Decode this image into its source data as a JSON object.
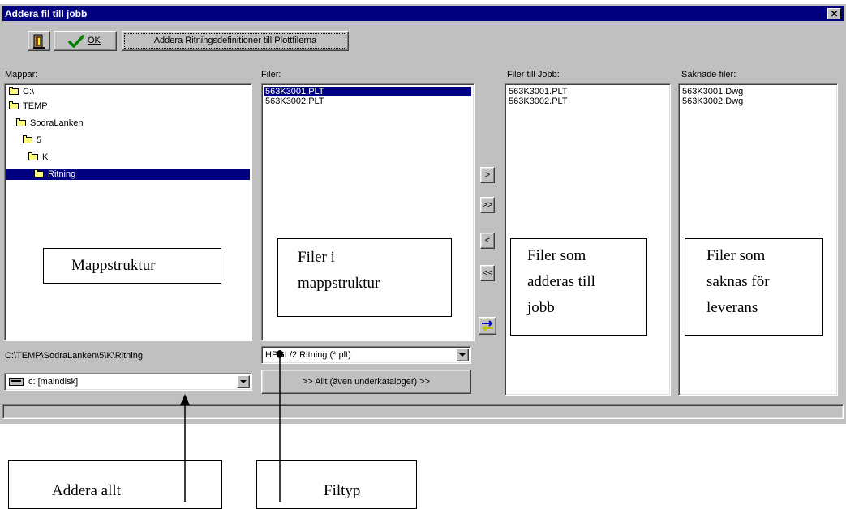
{
  "window": {
    "title": "Addera fil till jobb",
    "close_glyph": "✕"
  },
  "toolbar": {
    "ok_label": "OK",
    "add_defs_label": "Addera Ritningsdefinitioner till Plottfilerna"
  },
  "folders": {
    "label": "Mappar:",
    "items": [
      {
        "name": "C:\\",
        "icon": "open-folder-icon",
        "selected": false
      },
      {
        "name": "TEMP",
        "icon": "open-folder-icon",
        "selected": false
      },
      {
        "name": "SodraLanken",
        "icon": "open-folder-icon",
        "selected": false
      },
      {
        "name": "5",
        "icon": "open-folder-icon",
        "selected": false
      },
      {
        "name": "K",
        "icon": "open-folder-icon",
        "selected": false
      },
      {
        "name": "Ritning",
        "icon": "open-folder-icon",
        "selected": true
      }
    ],
    "current_path": "C:\\TEMP\\SodraLanken\\5\\K\\Ritning",
    "drive": "c: [maindisk]"
  },
  "files": {
    "label": "Filer:",
    "items": [
      "563K3001.PLT",
      "563K3002.PLT"
    ],
    "selected_index": 0,
    "filetype": "HPGL/2 Ritning (*.plt)",
    "add_all_label": ">> Allt (även underkataloger) >>"
  },
  "transfer_buttons": {
    "add": ">",
    "add_all": ">>",
    "remove": "<",
    "remove_all": "<<"
  },
  "job_files": {
    "label": "Filer till Jobb:",
    "items": [
      "563K3001.PLT",
      "563K3002.PLT"
    ]
  },
  "missing_files": {
    "label": "Saknade filer:",
    "items": [
      "563K3001.Dwg",
      "563K3002.Dwg"
    ]
  },
  "annotations": {
    "folder_structure": "Mappstruktur",
    "files_line1": "Filer i",
    "files_line2": "mappstruktur",
    "job_line1": "Filer som",
    "job_line2": "adderas till",
    "job_line3": "jobb",
    "missing_line1": "Filer som",
    "missing_line2": "saknas för",
    "missing_line3": "leverans",
    "add_all": "Addera allt",
    "filetype": "Filtyp"
  },
  "colors": {
    "titlebar": "#000080",
    "face": "#c0c0c0",
    "selection": "#000080",
    "check": "#008000"
  }
}
